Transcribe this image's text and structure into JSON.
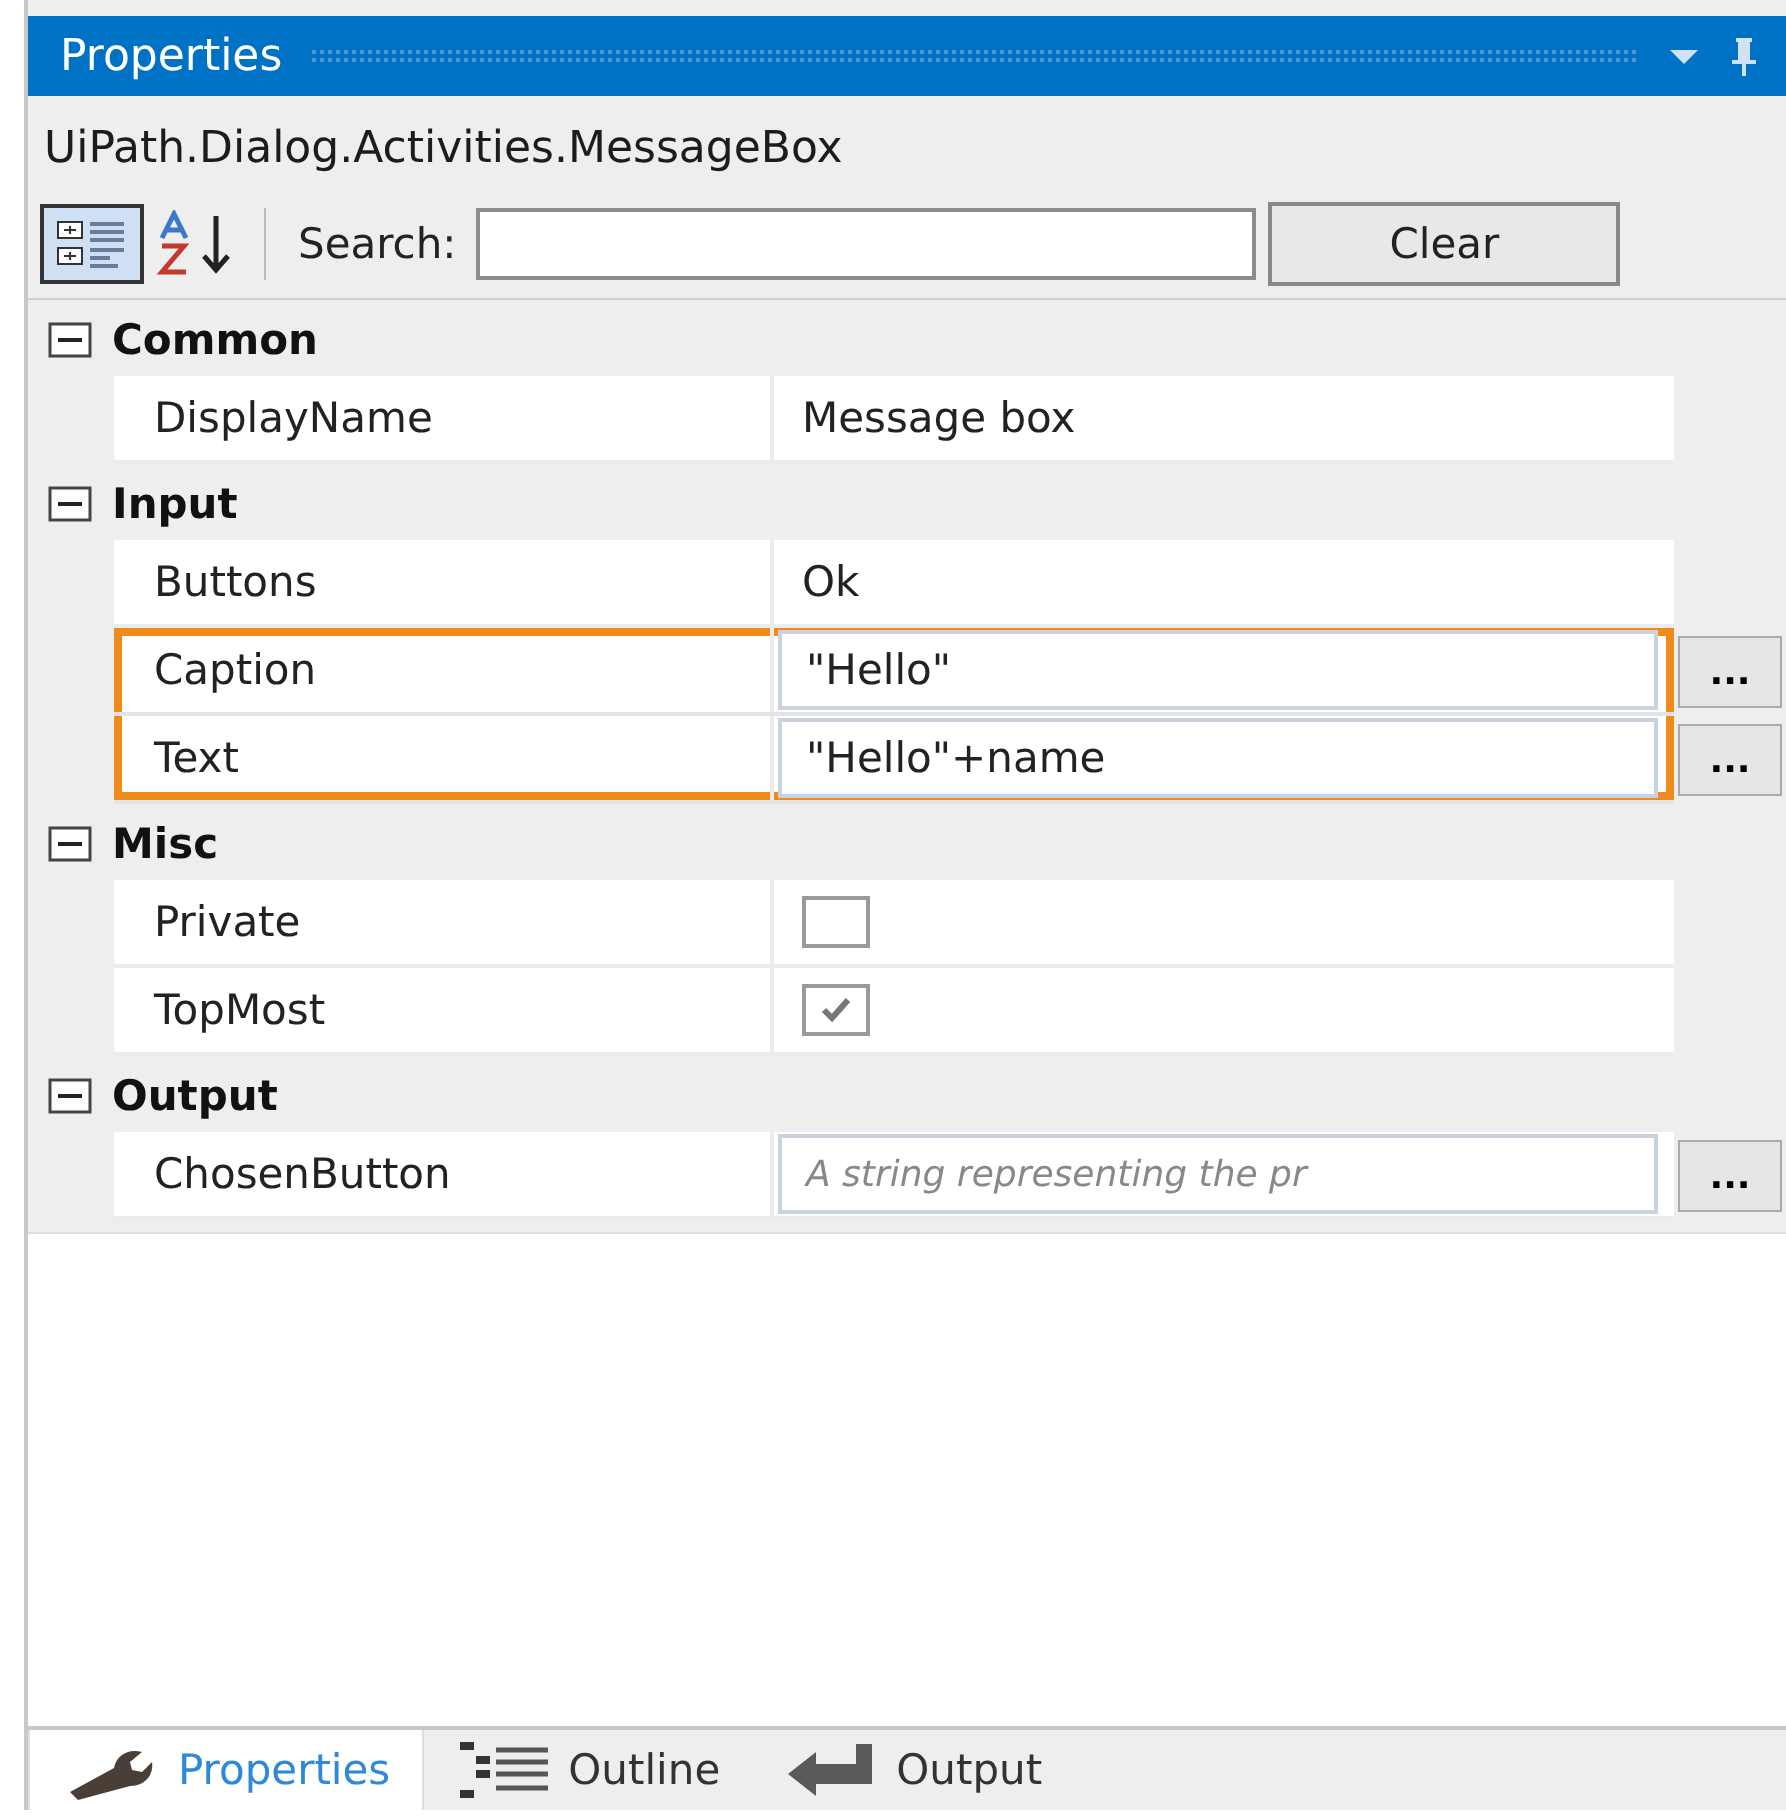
{
  "window": {
    "title": "Properties"
  },
  "object_type": "UiPath.Dialog.Activities.MessageBox",
  "toolbar": {
    "categorized_selected": true,
    "search_label": "Search:",
    "clear_button": "Clear"
  },
  "categories": [
    {
      "name": "Common",
      "expanded": true,
      "properties": [
        {
          "name": "DisplayName",
          "kind": "text",
          "value": "Message box",
          "highlighted": false
        }
      ]
    },
    {
      "name": "Input",
      "expanded": true,
      "properties": [
        {
          "name": "Buttons",
          "kind": "text",
          "value": "Ok",
          "highlighted": false
        },
        {
          "name": "Caption",
          "kind": "field",
          "value": "\"Hello\"",
          "button": "...",
          "highlighted": true
        },
        {
          "name": "Text",
          "kind": "field",
          "value": "\"Hello\"+name",
          "button": "...",
          "highlighted": true
        }
      ]
    },
    {
      "name": "Misc",
      "expanded": true,
      "properties": [
        {
          "name": "Private",
          "kind": "checkbox",
          "checked": false,
          "highlighted": false
        },
        {
          "name": "TopMost",
          "kind": "checkbox",
          "checked": true,
          "highlighted": false
        }
      ]
    },
    {
      "name": "Output",
      "expanded": true,
      "properties": [
        {
          "name": "ChosenButton",
          "kind": "field",
          "placeholder": "A string representing the pr",
          "button": "...",
          "highlighted": false
        }
      ]
    }
  ],
  "bottom_tabs": [
    {
      "label": "Properties",
      "selected": true
    },
    {
      "label": "Outline",
      "selected": false
    },
    {
      "label": "Output",
      "selected": false
    }
  ]
}
